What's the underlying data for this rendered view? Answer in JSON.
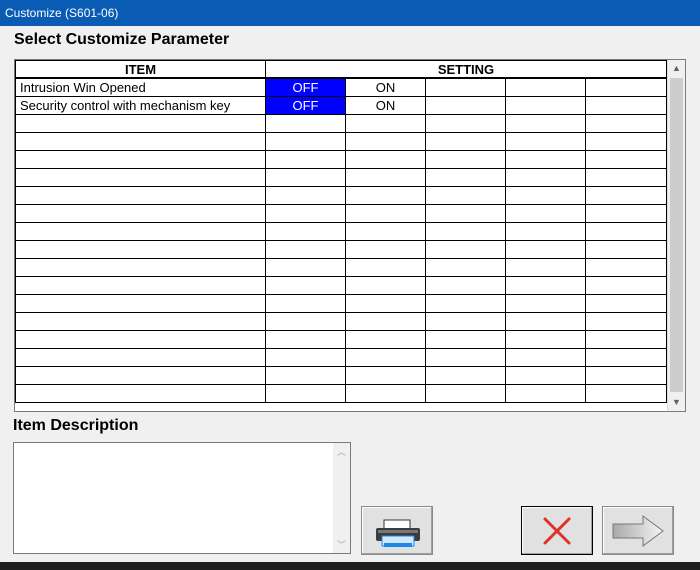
{
  "window": {
    "title": "Customize (S601-06)"
  },
  "section_titles": {
    "parameters": "Select Customize Parameter",
    "description": "Item Description"
  },
  "grid": {
    "headers": {
      "item": "ITEM",
      "setting": "SETTING"
    },
    "rows": [
      {
        "item": "Intrusion Win Opened",
        "options": [
          "OFF",
          "ON",
          "",
          "",
          ""
        ],
        "selected": "OFF"
      },
      {
        "item": "Security control with mechanism key",
        "options": [
          "OFF",
          "ON",
          "",
          "",
          ""
        ],
        "selected": "OFF"
      }
    ],
    "empty_row_count": 16
  },
  "description": {
    "text": ""
  },
  "buttons": {
    "print": {
      "icon": "printer-icon"
    },
    "cancel": {
      "icon": "red-x-icon"
    },
    "next": {
      "icon": "right-arrow-icon"
    }
  },
  "colors": {
    "titlebar": "#0a5bb4",
    "selected_cell": "#0000ff",
    "cancel_x": "#e0312c"
  }
}
